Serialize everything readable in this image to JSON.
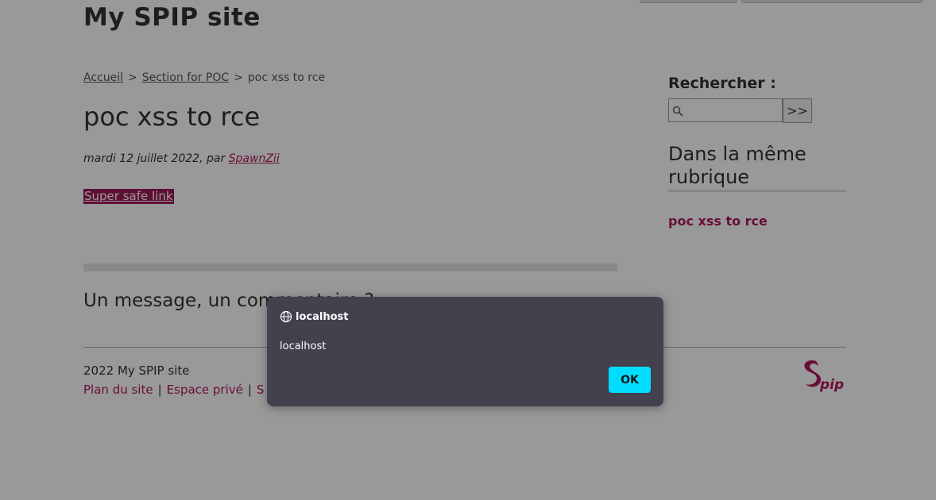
{
  "site": {
    "title": "My SPIP site"
  },
  "breadcrumb": {
    "home": "Accueil",
    "sep": ">",
    "section": "Section for POC",
    "current": "poc xss to rce"
  },
  "article": {
    "title": "poc xss to rce",
    "meta_prefix": "mardi 12 juillet 2022, par",
    "author": "SpawnZii",
    "link_text": "Super safe link"
  },
  "comments": {
    "heading": "Un message, un commentaire ?"
  },
  "footer": {
    "copyright": "2022 My SPIP site",
    "links": [
      "Plan du site",
      "Espace privé",
      "S"
    ],
    "separator": "|",
    "logo": "spip-logo"
  },
  "sidebar": {
    "search_label": "Rechercher  :",
    "search_value": "",
    "search_button": ">>",
    "same_rubrique_title": "Dans la même rubrique",
    "same_rubrique_items": [
      "poc xss to rce"
    ]
  },
  "dialog": {
    "origin": "localhost",
    "message": "localhost",
    "ok_label": "OK"
  },
  "colors": {
    "accent": "#b0185e",
    "dialog_bg": "#42414d",
    "dialog_button": "#00ddff",
    "overlay": "rgba(0,0,0,0.40)"
  }
}
